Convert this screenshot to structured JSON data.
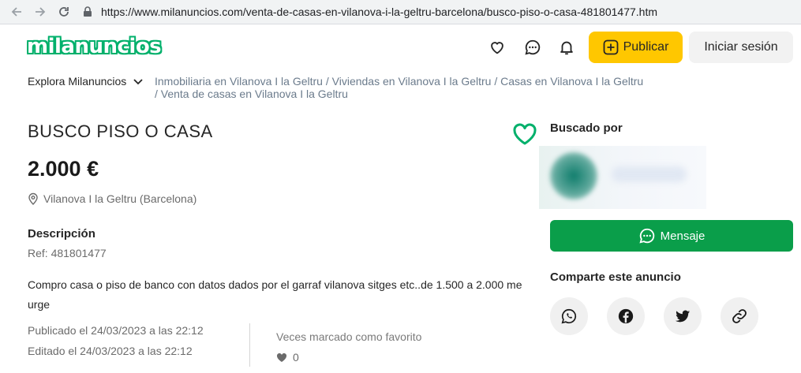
{
  "browser": {
    "url": "https://www.milanuncios.com/venta-de-casas-en-vilanova-i-la-geltru-barcelona/busco-piso-o-casa-481801477.htm"
  },
  "header": {
    "logo": "milanuncios",
    "publish_label": "Publicar",
    "login_label": "Iniciar sesión"
  },
  "breadcrumb": {
    "explore_label": "Explora Milanuncios",
    "items": [
      "Inmobiliaria en Vilanova I la Geltru",
      "Viviendas en Vilanova I la Geltru",
      "Casas en Vilanova I la Geltru",
      "Venta de casas en Vilanova I la Geltru"
    ],
    "separator": "/"
  },
  "ad": {
    "title": "BUSCO PISO O CASA",
    "price": "2.000 €",
    "location": "Vilanova I la Geltru (Barcelona)",
    "description_heading": "Descripción",
    "ref": "Ref: 481801477",
    "description": "Compro casa o piso de banco con datos dados por el garraf vilanova sitges etc..de 1.500 a 2.000 me urge",
    "published": "Publicado el 24/03/2023 a las 22:12",
    "edited": "Editado el 24/03/2023 a las 22:12",
    "favorites_label": "Veces marcado como favorito",
    "favorites_count": "0"
  },
  "sidebar": {
    "sought_by_label": "Buscado por",
    "message_label": "Mensaje",
    "share_label": "Comparte este anuncio",
    "share_icons": [
      "whatsapp-icon",
      "facebook-icon",
      "twitter-icon",
      "link-icon"
    ]
  },
  "colors": {
    "brand_green": "#00b06b",
    "message_button": "#0a9e4a",
    "publish_button": "#ffc700"
  }
}
